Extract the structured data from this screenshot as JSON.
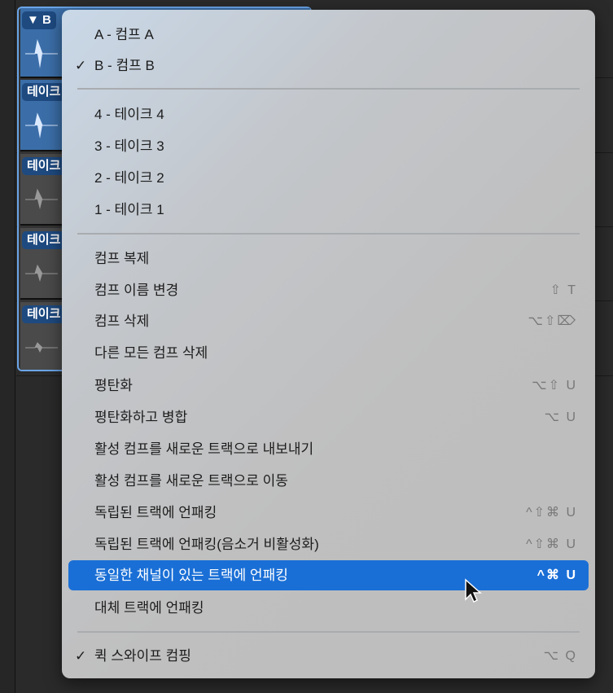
{
  "comp_header": {
    "label": "B"
  },
  "takes": [
    {
      "label": "테이크"
    },
    {
      "label": "테이크"
    },
    {
      "label": "테이크"
    },
    {
      "label": "테이크"
    }
  ],
  "menu": {
    "comps": [
      {
        "label": "A - 컴프 A",
        "checked": false
      },
      {
        "label": "B - 컴프 B",
        "checked": true
      }
    ],
    "takes": [
      {
        "label": "4 - 테이크 4"
      },
      {
        "label": "3 - 테이크 3"
      },
      {
        "label": "2 - 테이크 2"
      },
      {
        "label": "1 - 테이크 1"
      }
    ],
    "actions": [
      {
        "label": "컴프 복제",
        "shortcut": ""
      },
      {
        "label": "컴프 이름 변경",
        "shortcut": "⇧ T"
      },
      {
        "label": "컴프 삭제",
        "shortcut": "⌥⇧⌦"
      },
      {
        "label": "다른 모든 컴프 삭제",
        "shortcut": ""
      },
      {
        "label": "평탄화",
        "shortcut": "⌥⇧ U"
      },
      {
        "label": "평탄화하고 병합",
        "shortcut": "⌥ U"
      },
      {
        "label": "활성 컴프를 새로운 트랙으로 내보내기",
        "shortcut": ""
      },
      {
        "label": "활성 컴프를 새로운 트랙으로 이동",
        "shortcut": ""
      },
      {
        "label": "독립된 트랙에 언패킹",
        "shortcut": "^⇧⌘ U"
      },
      {
        "label": "독립된 트랙에 언패킹(음소거 비활성화)",
        "shortcut": "^⇧⌘ U"
      },
      {
        "label": "동일한 채널이 있는 트랙에 언패킹",
        "shortcut": "^⌘ U"
      },
      {
        "label": "대체 트랙에 언패킹",
        "shortcut": ""
      }
    ],
    "quick_swipe": {
      "label": "퀵 스와이프 컴핑",
      "checked": true,
      "check": "✓",
      "shortcut": "⌥ Q"
    },
    "check": "✓"
  },
  "colors": {
    "highlight": "#1a6fd6"
  }
}
